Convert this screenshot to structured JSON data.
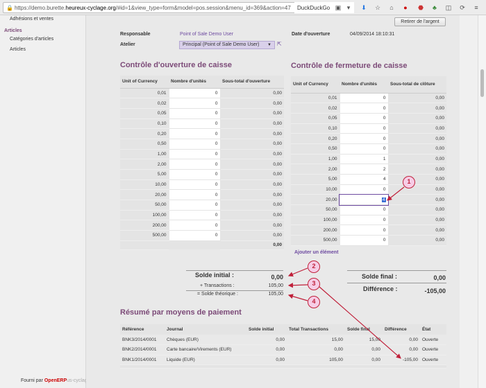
{
  "browser": {
    "url_prefix": "https://demo.burette.",
    "url_host": "heureux-cyclage.org",
    "url_rest": "/#id=1&view_type=form&model=pos.session&menu_id=369&action=47",
    "search_text": "DuckDuckGo"
  },
  "sidebar": {
    "item_adhesions": "Adhésions et ventes",
    "section_articles": "Articles",
    "item_categories": "Catégories d'articles",
    "item_articles": "Articles"
  },
  "footer": {
    "prefix": "Fourni par ",
    "brand": "OpenERP",
    "faded": "us-cyclage.org/#menu_id=369&action=473"
  },
  "header": {
    "retirer_label": "Retirer de l'argent",
    "responsable_label": "Responsable",
    "responsable_value": "Point of Sale Demo User",
    "atelier_label": "Atelier",
    "atelier_value": "Principal (Point of Sale Demo User)",
    "date_label": "Date d'ouverture",
    "date_value": "04/09/2014 18:10:31"
  },
  "opening": {
    "title": "Contrôle d'ouverture de caisse",
    "headers": [
      "Unit of Currency",
      "Nombre d'unités",
      "Sous-total d'ouverture"
    ],
    "rows": [
      [
        "0,01",
        "0",
        "0,00"
      ],
      [
        "0,02",
        "0",
        "0,00"
      ],
      [
        "0,05",
        "0",
        "0,00"
      ],
      [
        "0,10",
        "0",
        "0,00"
      ],
      [
        "0,20",
        "0",
        "0,00"
      ],
      [
        "0,50",
        "0",
        "0,00"
      ],
      [
        "1,00",
        "0",
        "0,00"
      ],
      [
        "2,00",
        "0",
        "0,00"
      ],
      [
        "5,00",
        "0",
        "0,00"
      ],
      [
        "10,00",
        "0",
        "0,00"
      ],
      [
        "20,00",
        "0",
        "0,00"
      ],
      [
        "50,00",
        "0",
        "0,00"
      ],
      [
        "100,00",
        "0",
        "0,00"
      ],
      [
        "200,00",
        "0",
        "0,00"
      ],
      [
        "500,00",
        "0",
        "0,00"
      ]
    ],
    "total": "0,00"
  },
  "closing": {
    "title": "Contrôle de fermeture de caisse",
    "headers": [
      "Unit of Currency",
      "Nombre d'unités",
      "Sous-total de clôture"
    ],
    "rows": [
      [
        "0,01",
        "0",
        "0,00"
      ],
      [
        "0,02",
        "0",
        "0,00"
      ],
      [
        "0,05",
        "0",
        "0,00"
      ],
      [
        "0,10",
        "0",
        "0,00"
      ],
      [
        "0,20",
        "0",
        "0,00"
      ],
      [
        "0,50",
        "0",
        "0,00"
      ],
      [
        "1,00",
        "1",
        "0,00"
      ],
      [
        "2,00",
        "2",
        "0,00"
      ],
      [
        "5,00",
        "4",
        "0,00"
      ],
      [
        "10,00",
        "0",
        "0,00"
      ],
      [
        "20,00",
        "4",
        "0,00"
      ],
      [
        "50,00",
        "0",
        "0,00"
      ],
      [
        "100,00",
        "0",
        "0,00"
      ],
      [
        "200,00",
        "0",
        "0,00"
      ],
      [
        "500,00",
        "0",
        "0,00"
      ]
    ],
    "add_line": "Ajouter un élément"
  },
  "summary": {
    "solde_initial_label": "Solde initial :",
    "solde_initial_value": "0,00",
    "transactions_label": "+ Transactions :",
    "transactions_value": "105,00",
    "solde_theorique_label": "= Solde théorique :",
    "solde_theorique_value": "105,00",
    "solde_final_label": "Solde final :",
    "solde_final_value": "0,00",
    "difference_label": "Différence :",
    "difference_value": "-105,00"
  },
  "resume": {
    "title": "Résumé par moyens de paiement",
    "headers": [
      "Référence",
      "Journal",
      "Solde initial",
      "Total Transactions",
      "Solde final",
      "Différence",
      "État"
    ],
    "rows": [
      [
        "BNK3/2014/0001",
        "Chèques (EUR)",
        "0,00",
        "15,00",
        "15,00",
        "0,00",
        "Ouverte"
      ],
      [
        "BNK2/2014/0001",
        "Carte bancaire/Virements (EUR)",
        "0,00",
        "0,00",
        "0,00",
        "0,00",
        "Ouverte"
      ],
      [
        "BNK1/2014/0001",
        "Liquide (EUR)",
        "0,00",
        "105,00",
        "0,00",
        "-105,00",
        "Ouverte"
      ]
    ]
  },
  "annotations": [
    "1",
    "2",
    "3",
    "4"
  ],
  "colors": {
    "accent": "#7c4a78",
    "link": "#6d4aa0",
    "badge": "#c0203a"
  }
}
